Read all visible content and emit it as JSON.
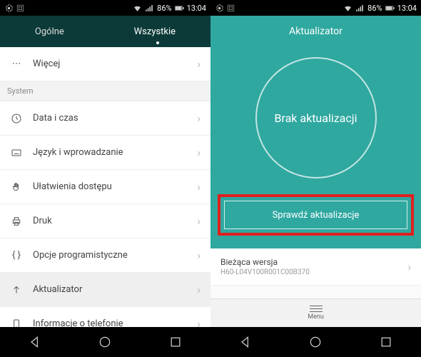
{
  "status": {
    "battery": "86%",
    "time": "13:04"
  },
  "left": {
    "tabs": {
      "general": "Ogólne",
      "all": "Wszystkie"
    },
    "more": "Więcej",
    "section": "System",
    "items": {
      "date": "Data i czas",
      "lang": "Język i wprowadzanie",
      "access": "Ułatwienia dostępu",
      "print": "Druk",
      "dev": "Opcje programistyczne",
      "updater": "Aktualizator",
      "about": "Informacje o telefonie"
    }
  },
  "right": {
    "title": "Aktualizator",
    "status": "Brak aktualizacji",
    "check_button": "Sprawdź aktualizacje",
    "version_label": "Bieżąca wersja",
    "version_value": "H60-L04V100R001C00B370",
    "menu": "Menu"
  }
}
